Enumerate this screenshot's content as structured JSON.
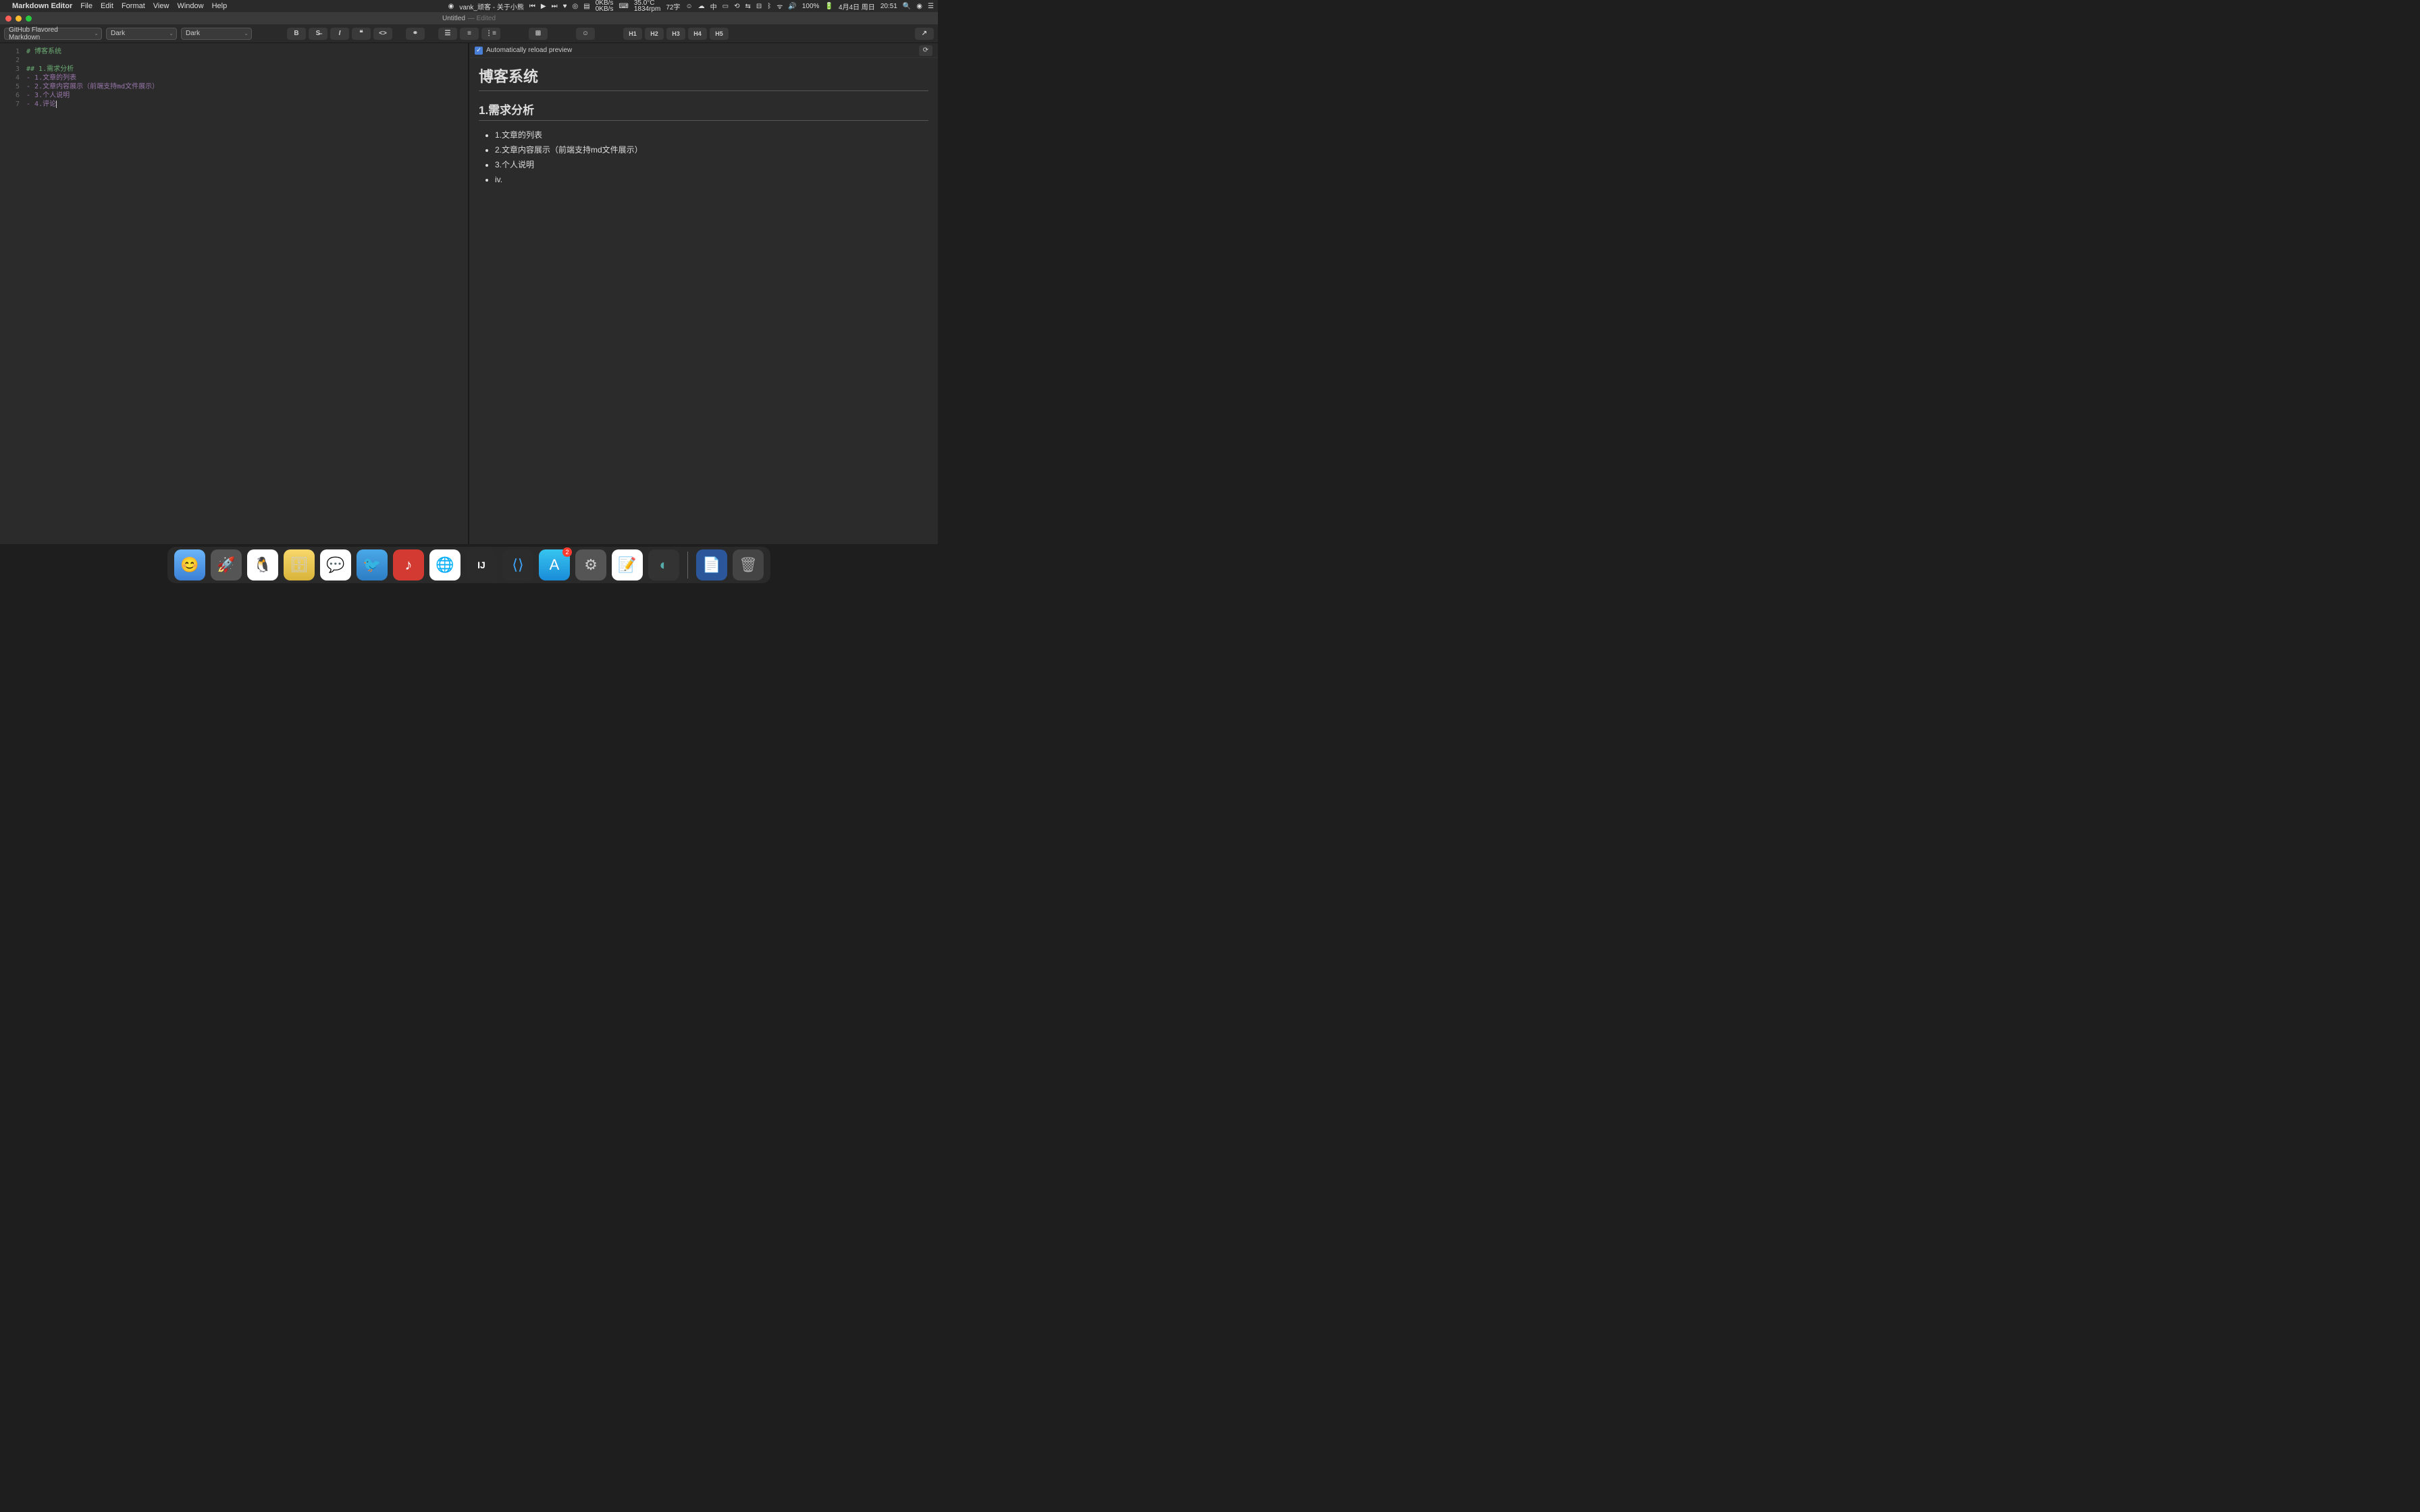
{
  "menubar": {
    "app_name": "Markdown Editor",
    "menus": [
      "File",
      "Edit",
      "Format",
      "View",
      "Window",
      "Help"
    ],
    "now_playing": "vank_顽客 - 关于小熊",
    "stats": {
      "net_up": "0KB/s",
      "net_down": "0KB/s",
      "temp": "35.0°C",
      "fan": "1834rpm",
      "chars": "72字"
    },
    "battery": "100%",
    "date": "4月4日 周日",
    "time": "20:51"
  },
  "titlebar": {
    "title": "Untitled",
    "edited": "— Edited"
  },
  "toolbar": {
    "flavor": "GitHub Flavored Markdown",
    "theme1": "Dark",
    "theme2": "Dark",
    "headings": [
      "H1",
      "H2",
      "H3",
      "H4",
      "H5"
    ]
  },
  "editor": {
    "lines": [
      {
        "n": "1",
        "type": "h1",
        "text": "# 博客系统"
      },
      {
        "n": "2",
        "type": "blank",
        "text": ""
      },
      {
        "n": "3",
        "type": "h2",
        "text": "## 1.需求分析"
      },
      {
        "n": "4",
        "type": "li",
        "marker": "- ",
        "text": "1.文章的列表"
      },
      {
        "n": "5",
        "type": "li",
        "marker": "- ",
        "text": "2.文章内容展示（前端支持md文件展示）"
      },
      {
        "n": "6",
        "type": "li",
        "marker": "- ",
        "text": "3.个人说明"
      },
      {
        "n": "7",
        "type": "li",
        "marker": "- ",
        "text": "4.评论",
        "cursor": true
      }
    ]
  },
  "preview": {
    "auto_reload_label": "Automatically reload preview",
    "h1": "博客系统",
    "h2": "1.需求分析",
    "items": [
      "1.文章的列表",
      "2.文章内容展示（前端支持md文件展示）",
      "3.个人说明",
      "iv."
    ]
  },
  "dock": {
    "badge_appstore": "2",
    "apps": [
      "finder",
      "launchpad",
      "qq",
      "db",
      "wechat",
      "bird",
      "netease",
      "chrome",
      "intellij",
      "vscode",
      "appstore",
      "settings",
      "notes",
      "safari"
    ],
    "right": [
      "word",
      "trash"
    ]
  }
}
